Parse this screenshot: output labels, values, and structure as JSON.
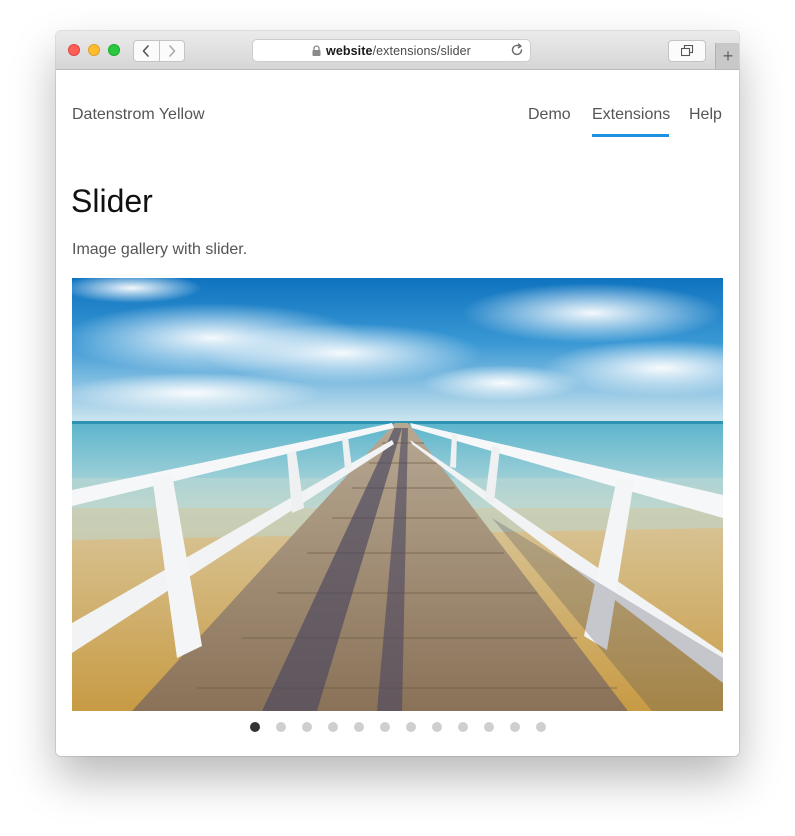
{
  "browser": {
    "url_host": "website",
    "url_path": "/extensions/slider",
    "icons": {
      "back": "chevron-left-icon",
      "forward": "chevron-right-icon",
      "lock": "lock-icon",
      "reload": "reload-icon",
      "tabs": "tab-overview-icon",
      "new_tab": "plus-icon"
    },
    "new_tab_label": "+"
  },
  "site": {
    "name": "Datenstrom Yellow",
    "menu": [
      {
        "label": "Demo",
        "active": false
      },
      {
        "label": "Extensions",
        "active": true
      },
      {
        "label": "Help",
        "active": false
      }
    ],
    "accent_color": "#1a92e0"
  },
  "content": {
    "title": "Slider",
    "description": "Image gallery with slider."
  },
  "slider": {
    "image": "pier-over-sea-photo",
    "slide_count": 12,
    "active_index": 0
  }
}
